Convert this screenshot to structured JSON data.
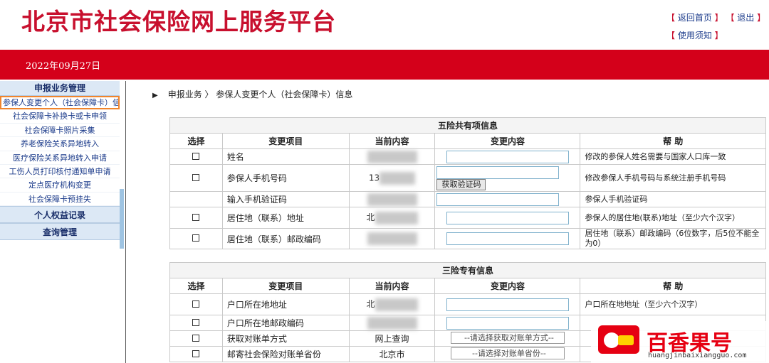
{
  "header": {
    "site_title": "北京市社会保险网上服务平台",
    "links": [
      {
        "label": "返回首页"
      },
      {
        "label": "退出"
      },
      {
        "label": "使用须知"
      }
    ],
    "date": "2022年09月27日",
    "brand_color": "#d4001a"
  },
  "sidebar": {
    "section1": "申报业务管理",
    "items": [
      {
        "label": "参保人变更个人（社会保障卡）信"
      },
      {
        "label": "社会保障卡补换卡或卡申领"
      },
      {
        "label": "社会保障卡照片采集"
      },
      {
        "label": "养老保险关系异地转入"
      },
      {
        "label": "医疗保险关系异地转入申请"
      },
      {
        "label": "工伤人员打印核付通知单申请"
      },
      {
        "label": "定点医疗机构变更"
      },
      {
        "label": "社会保障卡预挂失"
      }
    ],
    "section2": "个人权益记录",
    "section3": "查询管理"
  },
  "breadcrumb": "申报业务 〉 参保人变更个人（社会保障卡）信息",
  "table1": {
    "caption": "五险共有项信息",
    "headers": [
      "选择",
      "变更项目",
      "当前内容",
      "变更内容",
      "帮 助"
    ],
    "rows": [
      {
        "item": "姓名",
        "help": "修改的参保人姓名需要与国家人口库一致"
      },
      {
        "item": "参保人手机号码",
        "current": "13",
        "button": "获取验证码",
        "help": "修改参保人手机号码与系统注册手机号码"
      },
      {
        "item": "输入手机验证码",
        "help": "参保人手机验证码"
      },
      {
        "item": "居住地（联系）地址",
        "current": "北",
        "help": "参保人的居住地(联系)地址（至少六个汉字）"
      },
      {
        "item": "居住地（联系）邮政编码",
        "help": "居住地（联系）邮政编码（6位数字，后5位不能全为0）"
      }
    ]
  },
  "table2": {
    "caption": "三险专有信息",
    "headers": [
      "选择",
      "变更项目",
      "当前内容",
      "变更内容",
      "帮 助"
    ],
    "rows": [
      {
        "item": "户口所在地地址",
        "current": "北",
        "help": "户口所在地地址（至少六个汉字）"
      },
      {
        "item": "户口所在地邮政编码",
        "help": ""
      },
      {
        "item": "获取对账单方式",
        "current": "网上查询",
        "select": "--请选择获取对账单方式--",
        "help": ""
      },
      {
        "item": "邮寄社会保险对账单省份",
        "current": "北京市",
        "select": "--请选择对账单省份--",
        "help": ""
      }
    ]
  },
  "watermark": {
    "text": "百香果号",
    "url": "huangjinbaixiangguo.com"
  }
}
